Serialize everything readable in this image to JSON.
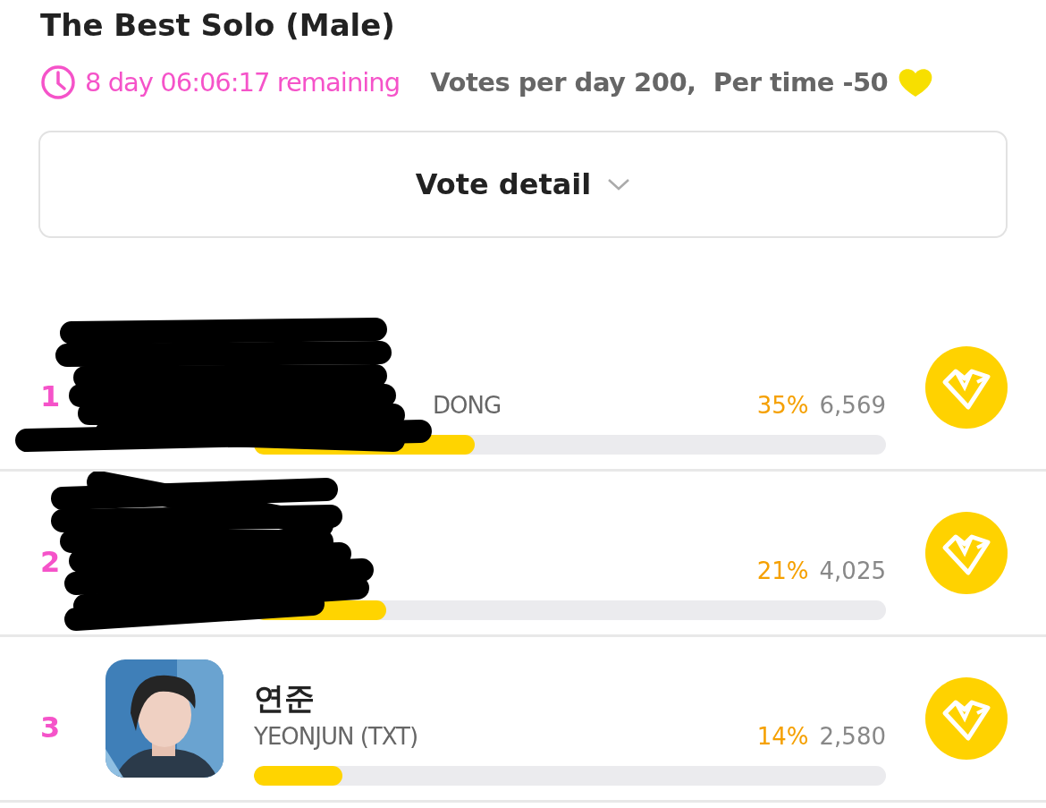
{
  "title": "The Best Solo (Male)",
  "timer": "8 day 06:06:17 remaining",
  "vote_info": "Votes per day 200,  Per time -50",
  "detail_button": "Vote detail",
  "candidates": [
    {
      "rank": "1",
      "redacted": true,
      "subtitle": "DONG",
      "percent": "35%",
      "votes": "6,569",
      "level": 0.35
    },
    {
      "rank": "2",
      "redacted": true,
      "percent": "21%",
      "votes": "4,025",
      "level": 0.21
    },
    {
      "rank": "3",
      "redacted": false,
      "name": "연준",
      "subtitle": "YEONJUN (TXT)",
      "percent": "14%",
      "votes": "2,580",
      "level": 0.14
    }
  ]
}
